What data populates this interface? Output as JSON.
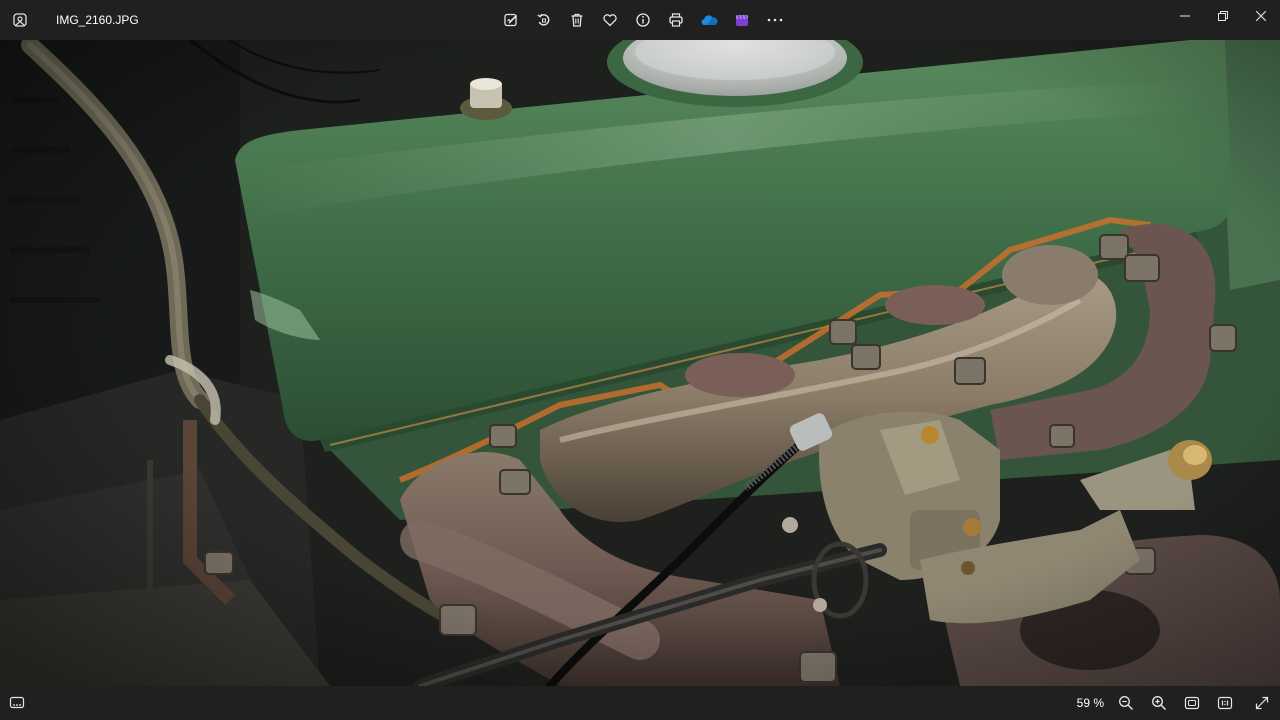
{
  "window": {
    "file_name": "IMG_2160.JPG"
  },
  "toolbar": {
    "items": [
      {
        "name": "edit-image",
        "icon": "edit-image-icon"
      },
      {
        "name": "rotate",
        "icon": "rotate-icon"
      },
      {
        "name": "delete",
        "icon": "trash-icon"
      },
      {
        "name": "favorite",
        "icon": "heart-icon"
      },
      {
        "name": "info",
        "icon": "info-icon"
      },
      {
        "name": "print",
        "icon": "printer-icon"
      },
      {
        "name": "onedrive",
        "icon": "cloud-icon"
      },
      {
        "name": "clipchamp",
        "icon": "clipchamp-icon"
      },
      {
        "name": "more",
        "icon": "more-icon"
      }
    ]
  },
  "statusbar": {
    "zoom_label": "59 %"
  },
  "colors": {
    "chrome_bg": "#202020",
    "engine_green": "#3f6a44",
    "onedrive_blue": "#1f8ae0",
    "clipchamp_purple": "#8b4fd9"
  }
}
